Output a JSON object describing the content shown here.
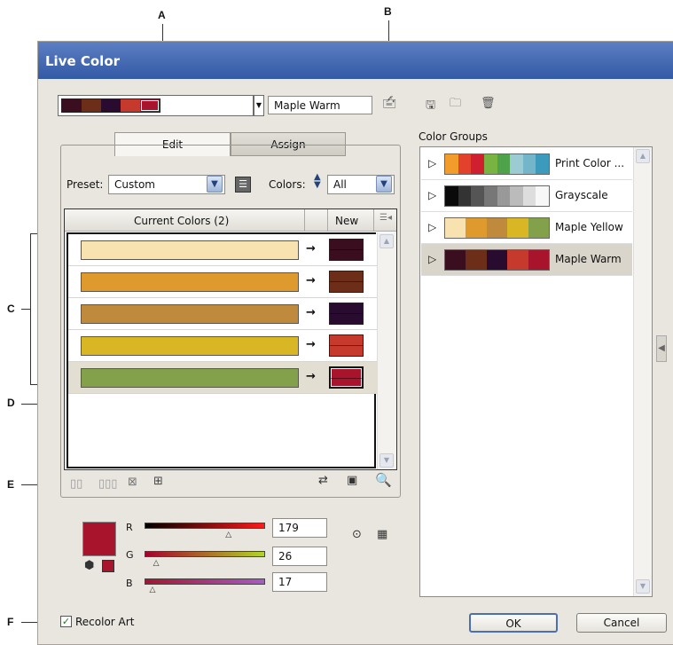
{
  "callouts": {
    "a": "A",
    "b": "B",
    "c": "C",
    "d": "D",
    "e": "E",
    "f": "F"
  },
  "dialog": {
    "title": "Live Color"
  },
  "active_group": {
    "name": "Maple Warm",
    "swatches": [
      "#3a0e1e",
      "#6c2e18",
      "#2a0b30",
      "#c53a2c",
      "#a8142c"
    ]
  },
  "tabs": {
    "edit": "Edit",
    "assign": "Assign"
  },
  "preset": {
    "label": "Preset:",
    "value": "Custom"
  },
  "colors": {
    "label": "Colors:",
    "value": "All"
  },
  "table": {
    "current_header": "Current Colors (2)",
    "new_header": "New",
    "rows": [
      {
        "current": "#f7e2b0",
        "new": "#3a0e1e"
      },
      {
        "current": "#df9a2e",
        "new": "#6c2e18"
      },
      {
        "current": "#bf8a3c",
        "new": "#2a0b30"
      },
      {
        "current": "#d9b623",
        "new": "#c53a2c"
      },
      {
        "current": "#83a14a",
        "new": "#a8142c"
      }
    ]
  },
  "color_groups": {
    "title": "Color Groups",
    "items": [
      {
        "name": "Print Color ...",
        "swatches": [
          "#f29d2b",
          "#e2422b",
          "#d01f2e",
          "#79b443",
          "#4ea34a",
          "#9dcbd3",
          "#74b6c9",
          "#3c9bbd"
        ]
      },
      {
        "name": "Grayscale",
        "swatches": [
          "#0a0a0a",
          "#333333",
          "#555555",
          "#777777",
          "#999999",
          "#bbbbbb",
          "#dddddd",
          "#f7f7f7"
        ]
      },
      {
        "name": "Maple Yellow",
        "swatches": [
          "#f7e2b0",
          "#df9a2e",
          "#bf8a3c",
          "#d9b623",
          "#83a14a"
        ]
      },
      {
        "name": "Maple Warm",
        "swatches": [
          "#3a0e1e",
          "#6c2e18",
          "#2a0b30",
          "#c53a2c",
          "#a8142c"
        ]
      }
    ]
  },
  "sliders": {
    "r": {
      "label": "R",
      "value": "179",
      "fraction": 0.7
    },
    "g": {
      "label": "G",
      "value": "26",
      "fraction": 0.1
    },
    "b": {
      "label": "B",
      "value": "17",
      "fraction": 0.07
    }
  },
  "current_color": "#a8142c",
  "recolor_art": {
    "label": "Recolor Art",
    "checked": true
  },
  "buttons": {
    "ok": "OK",
    "cancel": "Cancel"
  }
}
